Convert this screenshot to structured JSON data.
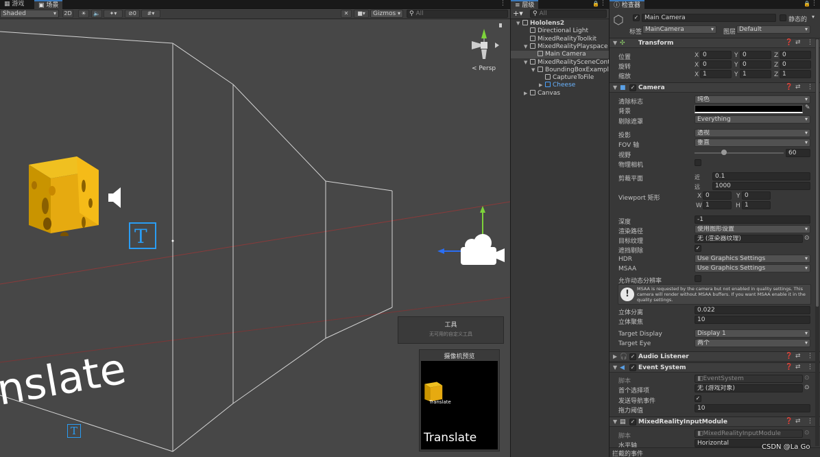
{
  "scene": {
    "tabs": [
      "游戏",
      "场景"
    ],
    "shading_mode": "Shaded",
    "mode_2d": "2D",
    "hidden_count": "0",
    "gizmos_label": "Gizmos",
    "search_placeholder": "All",
    "persp_label": "< Persp",
    "world_text": "nslate",
    "tools_overlay": {
      "title": "工具",
      "subtitle": "无可用的自定义工具"
    },
    "camera_preview": {
      "title": "摄像机预览",
      "small_text": "Translate",
      "big_text": "Translate"
    }
  },
  "hierarchy": {
    "tab": "层级",
    "search_placeholder": "All",
    "items": [
      {
        "label": "Hololens2",
        "depth": 0,
        "bold": true
      },
      {
        "label": "Directional Light",
        "depth": 1
      },
      {
        "label": "MixedRealityToolkit",
        "depth": 1
      },
      {
        "label": "MixedRealityPlayspace",
        "depth": 1
      },
      {
        "label": "Main Camera",
        "depth": 2,
        "selected": true
      },
      {
        "label": "MixedRealitySceneContent",
        "depth": 1
      },
      {
        "label": "BoundingBoxExample",
        "depth": 2
      },
      {
        "label": "CaptureToFile",
        "depth": 3
      },
      {
        "label": "Cheese",
        "depth": 3,
        "blue": true
      },
      {
        "label": "Canvas",
        "depth": 1
      }
    ]
  },
  "inspector": {
    "tab": "检查器",
    "object_name": "Main Camera",
    "static_label": "静态的",
    "tag_label": "标签",
    "tag_value": "MainCamera",
    "layer_label": "图层",
    "layer_value": "Default",
    "transform": {
      "title": "Transform",
      "rows": [
        {
          "label": "位置",
          "x": "0",
          "y": "0",
          "z": "0"
        },
        {
          "label": "旋转",
          "x": "0",
          "y": "0",
          "z": "0"
        },
        {
          "label": "缩放",
          "x": "1",
          "y": "1",
          "z": "1"
        }
      ]
    },
    "camera": {
      "title": "Camera",
      "clear_flags_label": "清除标志",
      "clear_flags": "纯色",
      "background_label": "背景",
      "culling_label": "剔除遮罩",
      "culling": "Everything",
      "projection_label": "投影",
      "projection": "透视",
      "fov_axis_label": "FOV 轴",
      "fov_axis": "垂直",
      "fov_label": "视野",
      "fov": "60",
      "fov_fraction": 0.33,
      "physical_label": "物理相机",
      "clipping_label": "剪裁平面",
      "near_label": "近",
      "near": "0.1",
      "far_label": "远",
      "far": "1000",
      "viewport_label": "Viewport 矩形",
      "vx": "0",
      "vy": "0",
      "vw": "1",
      "vh": "1",
      "depth_label": "深度",
      "depth": "-1",
      "render_path_label": "渲染路径",
      "render_path": "使用图形设置",
      "target_tex_label": "目标纹理",
      "target_tex": "无 (渲染器纹理)",
      "occlusion_label": "遮挡剔除",
      "hdr_label": "HDR",
      "hdr": "Use Graphics Settings",
      "msaa_label": "MSAA",
      "msaa": "Use Graphics Settings",
      "dynamic_res_label": "允许动态分辨率",
      "msaa_warning": "MSAA is requested by the camera but not enabled in quality settings. This camera will render without MSAA buffers. If you want MSAA enable it in the quality settings.",
      "stereo_sep_label": "立体分离",
      "stereo_sep": "0.022",
      "stereo_conv_label": "立体聚焦",
      "stereo_conv": "10",
      "target_display_label": "Target Display",
      "target_display": "Display 1",
      "target_eye_label": "Target Eye",
      "target_eye": "两个"
    },
    "audio_listener": {
      "title": "Audio Listener"
    },
    "event_system": {
      "title": "Event System",
      "script_label": "脚本",
      "script": "EventSystem",
      "first_selected_label": "首个选择项",
      "first_selected": "无 (游戏对象)",
      "send_nav_label": "发送导航事件",
      "drag_label": "拖力阈值",
      "drag": "10"
    },
    "input_module": {
      "title": "MixedRealityInputModule",
      "script_label": "脚本",
      "script": "MixedRealityInputModule",
      "horizontal_label": "水平轴",
      "horizontal": "Horizontal"
    },
    "footer": "拦截的事件",
    "watermark": "CSDN @La Go"
  }
}
